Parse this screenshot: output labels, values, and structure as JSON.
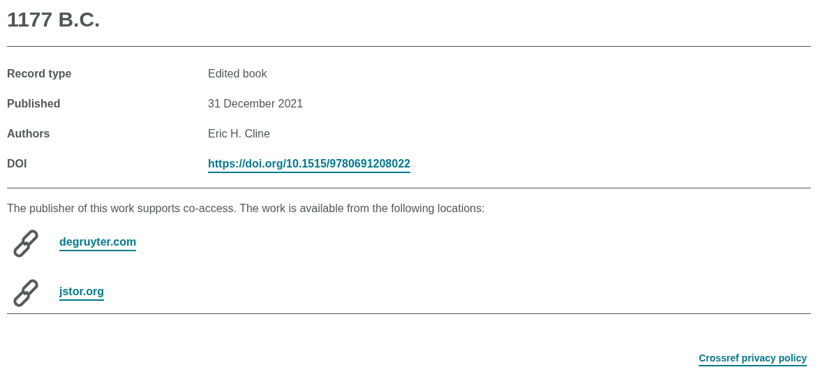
{
  "title": "1177 B.C.",
  "fields": [
    {
      "label": "Record type",
      "value": "Edited book",
      "kind": "text"
    },
    {
      "label": "Published",
      "value": "31 December 2021",
      "kind": "text"
    },
    {
      "label": "Authors",
      "value": "Eric H. Cline",
      "kind": "text"
    },
    {
      "label": "DOI",
      "value": "https://doi.org/10.1515/9780691208022",
      "kind": "link"
    }
  ],
  "access_note": "The publisher of this work supports co-access. The work is available from the following locations:",
  "locations": [
    {
      "label": "degruyter.com"
    },
    {
      "label": "jstor.org"
    }
  ],
  "footer_link": "Crossref privacy policy"
}
